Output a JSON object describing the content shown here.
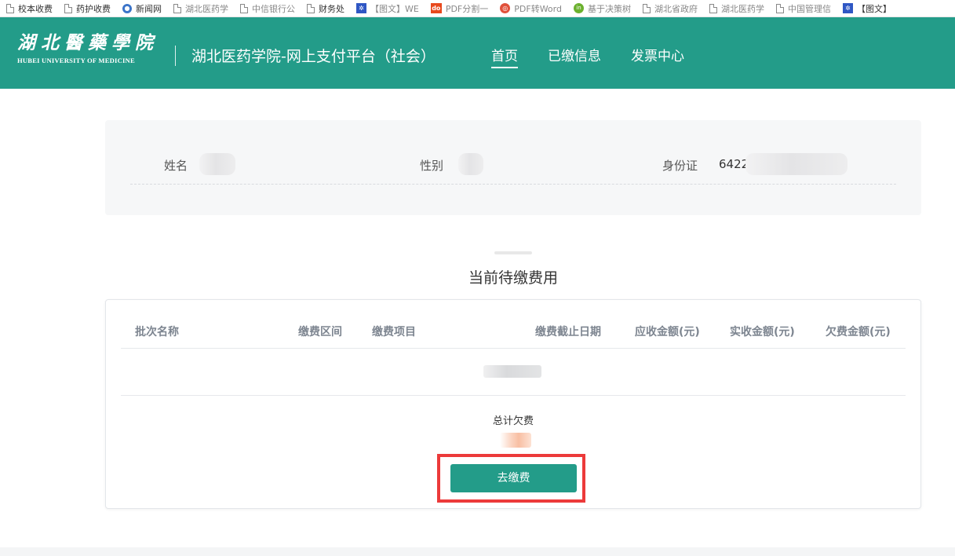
{
  "bookmarks": [
    {
      "label": "校本收费",
      "icon": "page-icon"
    },
    {
      "label": "药护收费",
      "icon": "page-icon"
    },
    {
      "label": "新闻网",
      "icon": "globe-icon"
    },
    {
      "label": "湖北医药学",
      "icon": "page-icon"
    },
    {
      "label": "中信银行公",
      "icon": "page-icon"
    },
    {
      "label": "财务处",
      "icon": "page-icon"
    },
    {
      "label": "【图文】WE",
      "icon": "paw-icon"
    },
    {
      "label": "PDF分割一",
      "icon": "pdf-icon"
    },
    {
      "label": "PDF转Word",
      "icon": "convert-icon"
    },
    {
      "label": "基于决策树",
      "icon": "green-icon"
    },
    {
      "label": "湖北省政府",
      "icon": "page-icon"
    },
    {
      "label": "湖北医药学",
      "icon": "page-icon"
    },
    {
      "label": "中国管理信",
      "icon": "page-icon"
    },
    {
      "label": "【图文】",
      "icon": "paw-icon"
    }
  ],
  "header": {
    "logo_cn": "湖北醫藥學院",
    "logo_en": "HUBEI UNIVERSITY OF MEDICINE",
    "site_title": "湖北医药学院-网上支付平台（社会）",
    "nav": [
      {
        "label": "首页",
        "active": true
      },
      {
        "label": "已缴信息",
        "active": false
      },
      {
        "label": "发票中心",
        "active": false
      }
    ],
    "bg_color": "#239c89"
  },
  "profile": {
    "name_label": "姓名",
    "gender_label": "性别",
    "id_label": "身份证",
    "id_value_prefix": "6422"
  },
  "fees": {
    "section_title": "当前待缴费用",
    "columns": [
      "批次名称",
      "缴费区间",
      "缴费项目",
      "缴费截止日期",
      "应收金额(元)",
      "实收金额(元)",
      "欠费金额(元)"
    ],
    "total_label": "总计欠费",
    "pay_button": "去缴费",
    "highlight_color": "#ec3a3a"
  }
}
